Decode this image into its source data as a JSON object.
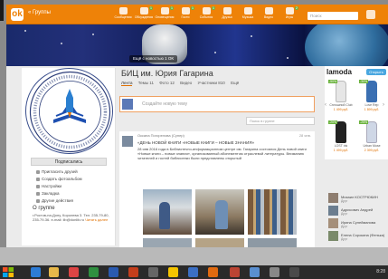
{
  "topbar": {
    "logo": "ok",
    "breadcrumb": "« Группы",
    "nav": [
      {
        "label": "Сообщения",
        "badge": ""
      },
      {
        "label": "Обсуждения",
        "badge": "1"
      },
      {
        "label": "Оповещения",
        "badge": "1"
      },
      {
        "label": "Гости",
        "badge": "1"
      },
      {
        "label": "События",
        "badge": "1"
      },
      {
        "label": "Друзья",
        "badge": ""
      },
      {
        "label": "Музыка",
        "badge": ""
      },
      {
        "label": "Видео",
        "badge": ""
      },
      {
        "label": "Игры",
        "badge": "2"
      },
      {
        "label": "Фото",
        "badge": "1"
      }
    ],
    "search_placeholder": "Поиск",
    "accent": "#ee8208"
  },
  "cover": {
    "upload_label": "Ещё с новостью 1 ОК"
  },
  "sidebar": {
    "subscribe_button": "Подписались",
    "items": [
      "Пригласить друзей",
      "Создать фотоальбом",
      "Настройки",
      "Закладка",
      "Другие действия"
    ],
    "about_title": "О группе",
    "about_text": "г.Ростов-на-Дону, Королева 3. Тел. 235-79-80, 235-79-36. e-mail: lib@donlib.ru",
    "about_link": "Читать далее"
  },
  "group": {
    "title": "БИЦ им. Юрия Гагарина",
    "tabs": [
      "Лента",
      "Темы 11",
      "Фото 12",
      "Видео",
      "Участники 810",
      "Ещё"
    ],
    "composer_placeholder": "Создайте новую тему",
    "feed_search_placeholder": "Поиск в группе"
  },
  "post": {
    "author": "Оксана Погорелова (Супер)",
    "meta": "28 янв.",
    "title": "«ДЕНЬ НОВОЙ КНИГИ «НОВЫЕ КНИГИ – НОВЫЕ ЗНАНИЯ»",
    "text": "28 янв 2016 года в Библиотечно-информационном центре им. Гагарина состоялся День новой книги «Новые книги – новые знания», организованный абонементом отраслевой литературы. Вниманию читателей и гостей библиотеки были представлены открытый"
  },
  "ad": {
    "brand": "lamoda",
    "button": "Открыть",
    "items": [
      {
        "name": "Сплошной Club",
        "price": "1 499 руб.",
        "discount": "-50%",
        "color": "#e0e0e0"
      },
      {
        "name": "Love Rep",
        "price": "1 899 руб.",
        "discount": "-30%",
        "color": "#3a6fb2"
      },
      {
        "name": "LOST ink",
        "price": "1 499 руб.",
        "discount": "-20%",
        "color": "#222222"
      },
      {
        "name": "Urban Muse",
        "price": "2 399 руб.",
        "discount": "-25%",
        "color": "#cfd7e6"
      }
    ]
  },
  "people": [
    {
      "name": "Михаил КОСТРЮКИН",
      "sub": "Друг"
    },
    {
      "name": "Адрисович Андрей",
      "sub": "Друг"
    },
    {
      "name": "Ирина Сулейманова",
      "sub": "Друг"
    },
    {
      "name": "Елена Сорокина (Фенька)",
      "sub": "Друг"
    }
  ],
  "taskbar": {
    "time": "8:28"
  }
}
